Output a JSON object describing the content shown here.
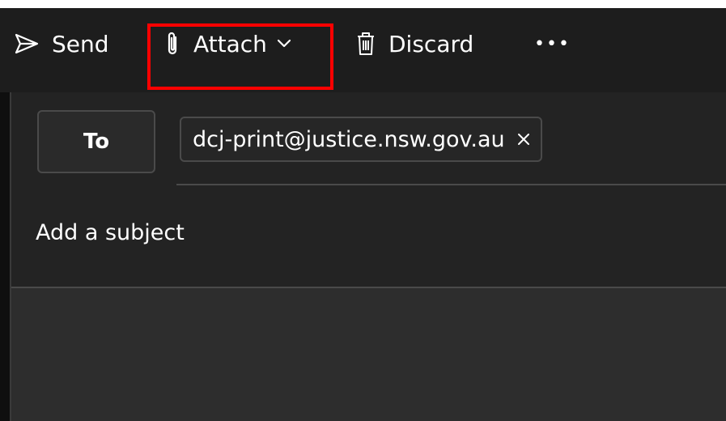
{
  "toolbar": {
    "send_label": "Send",
    "attach_label": "Attach",
    "discard_label": "Discard",
    "more_label": "•••"
  },
  "compose": {
    "to_label": "To",
    "recipient": "dcj-print@justice.nsw.gov.au",
    "subject_placeholder": "Add a subject"
  },
  "colors": {
    "highlight": "#ff0000",
    "toolbar_bg": "#1d1d1d",
    "compose_bg": "#232323",
    "text": "#ffffff"
  },
  "icons": [
    "send-icon",
    "paperclip-icon",
    "chevron-down-icon",
    "trash-icon",
    "more-icon",
    "close-icon"
  ]
}
